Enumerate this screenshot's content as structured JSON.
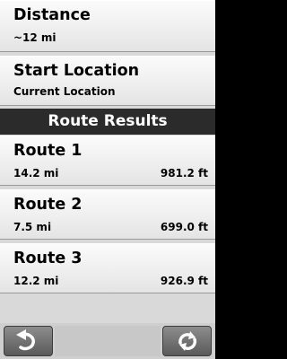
{
  "settings": {
    "distance": {
      "title": "Distance",
      "value": "~12 mi"
    },
    "start_location": {
      "title": "Start Location",
      "value": "Current Location"
    }
  },
  "results_header": "Route Results",
  "routes": [
    {
      "name": "Route 1",
      "distance": "14.2 mi",
      "elevation": "981.2 ft"
    },
    {
      "name": "Route 2",
      "distance": "7.5 mi",
      "elevation": "699.0 ft"
    },
    {
      "name": "Route 3",
      "distance": "12.2 mi",
      "elevation": "926.9 ft"
    }
  ],
  "toolbar": {
    "back_icon": "back-arrow-icon",
    "refresh_icon": "refresh-icon"
  },
  "colors": {
    "header_bg": "#2b2b2b",
    "row_bg": "#f1f1f1",
    "button_bg": "#6e6e6e"
  }
}
